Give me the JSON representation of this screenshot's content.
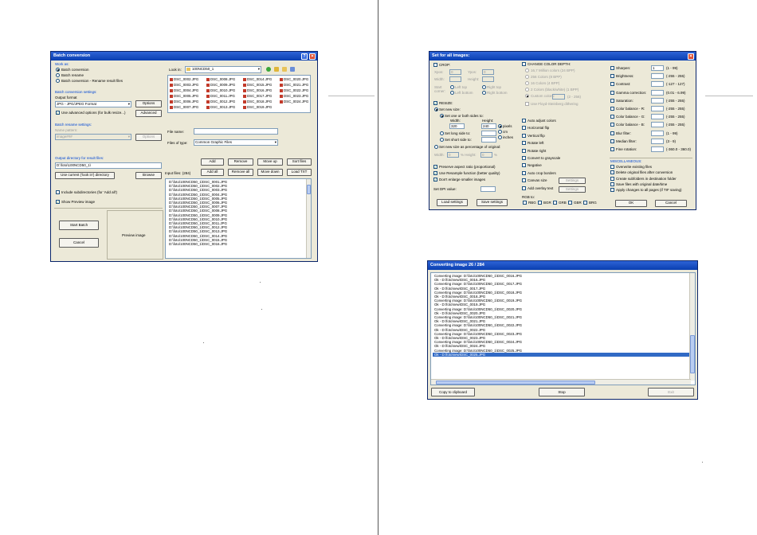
{
  "batch": {
    "title": "Batch conversion",
    "work_as": "Work as:",
    "mode_conversion": "Batch conversion",
    "mode_rename": "Batch rename",
    "mode_both": "Batch conversion - Rename result files",
    "settings_title": "Batch conversion settings:",
    "output_format_label": "Output format",
    "output_format": "JPG - JPG/JPEG Format",
    "options_btn": "Options",
    "advanced_check": "Use advanced options (for bulk resize...)",
    "advanced_btn": "Advanced",
    "rename_title": "Batch rename settings:",
    "name_pattern_label": "Name pattern:",
    "name_pattern": "image###",
    "rename_options_btn": "Options",
    "outdir_title": "Output directory for result files:",
    "outdir": "D:\\foto\\100NCD50_1\\",
    "use_current_btn": "Use current ('look in') directory",
    "browse_btn": "Browse",
    "include_subdirs": "Include subdirectories (for 'Add all')",
    "show_preview": "Show Preview image",
    "start_btn": "Start Batch",
    "cancel_btn": "Cancel",
    "preview_label": "Preview image",
    "look_in_label": "Look in:",
    "look_in": "100NCD50_1",
    "files": [
      "DSC_0002.JPG",
      "DSC_0003.JPG",
      "DSC_0004.JPG",
      "DSC_0005.JPG",
      "DSC_0006.JPG",
      "DSC_0007.JPG",
      "DSC_0008.JPG",
      "DSC_0009.JPG",
      "DSC_0010.JPG",
      "DSC_0011.JPG",
      "DSC_0012.JPG",
      "DSC_0013.JPG",
      "DSC_0014.JPG",
      "DSC_0015.JPG",
      "DSC_0016.JPG",
      "DSC_0017.JPG",
      "DSC_0018.JPG",
      "DSC_0019.JPG",
      "DSC_0020.JPG",
      "DSC_0021.JPG",
      "DSC_0022.JPG",
      "DSC_0023.JPG",
      "DSC_0024.JPG"
    ],
    "file_name_label": "File name:",
    "file_name": "",
    "file_type_label": "Files of type:",
    "file_type": "Common Graphic Files",
    "add_btn": "Add",
    "remove_btn": "Remove",
    "moveup_btn": "Move up",
    "sort_btn": "Sort files",
    "input_files_label": "Input files: (284)",
    "addall_btn": "Add all",
    "removeall_btn": "Remove all",
    "movedown_btn": "Move down",
    "loadtxt_btn": "Load TXT",
    "input_files": [
      "D:\\foto\\100NCD50_1\\DSC_0001.JPG",
      "D:\\foto\\100NCD50_1\\DSC_0002.JPG",
      "D:\\foto\\100NCD50_1\\DSC_0003.JPG",
      "D:\\foto\\100NCD50_1\\DSC_0004.JPG",
      "D:\\foto\\100NCD50_1\\DSC_0005.JPG",
      "D:\\foto\\100NCD50_1\\DSC_0006.JPG",
      "D:\\foto\\100NCD50_1\\DSC_0007.JPG",
      "D:\\foto\\100NCD50_1\\DSC_0008.JPG",
      "D:\\foto\\100NCD50_1\\DSC_0009.JPG",
      "D:\\foto\\100NCD50_1\\DSC_0010.JPG",
      "D:\\foto\\100NCD50_1\\DSC_0011.JPG",
      "D:\\foto\\100NCD50_1\\DSC_0012.JPG",
      "D:\\foto\\100NCD50_1\\DSC_0013.JPG",
      "D:\\foto\\100NCD50_1\\DSC_0014.JPG",
      "D:\\foto\\100NCD50_1\\DSC_0015.JPG",
      "D:\\foto\\100NCD50_1\\DSC_0016.JPG"
    ]
  },
  "setall": {
    "title": "Set for all images:",
    "crop": "CROP:",
    "xpos": "Xpos:",
    "ypos": "Ypos:",
    "width": "Width:",
    "height": "Height:",
    "xpos_val": "0",
    "ypos_val": "0",
    "start_corner": "Start corner:",
    "left_top": "Left top",
    "right_top": "Right top",
    "left_bottom": "Left bottom",
    "right_bottom": "Right bottom",
    "resize": "RESIZE:",
    "set_new_size": "Set new size:",
    "set_one_or_both": "Set one or both sides to:",
    "width_lbl": "Width:",
    "height_lbl": "Height:",
    "new_width": "320",
    "new_height": "240",
    "pixels": "pixels",
    "cm": "cm",
    "inches": "inches",
    "set_long": "Set long side to:",
    "set_short": "Set short side to:",
    "set_pct": "Set new size as percentage of original:",
    "pct_w": "Width:",
    "pct_w_val": "0",
    "pct_pct": "%",
    "pct_h": "% Height:",
    "pct_h_val": "0",
    "preserve": "Preserve aspect ratio (proportional)",
    "resample": "Use Resample function (better quality)",
    "dont_enlarge": "Don't enlarge smaller images",
    "dpi": "Set DPI value:",
    "load_btn": "Load settings",
    "save_btn": "Save settings",
    "color_depth": "CHANGE COLOR DEPTH:",
    "depths": [
      "16,7 Million colors (24 BPP)",
      "256 Colors (8 BPP)",
      "16 Colors (4 BPP)",
      "2 Colors (black/white) (1 BPP)",
      "Custom colors:"
    ],
    "custom_range": "(2 - 256)",
    "floyd": "Use Floyd-Steinberg dithering",
    "auto_adjust": "Auto adjust colors",
    "hflip": "Horizontal flip",
    "vflip": "Vertical flip",
    "rot_left": "Rotate left",
    "rot_right": "Rotate right",
    "grayscale": "Convert to grayscale",
    "negative": "Negative",
    "autocrop": "Auto crop borders",
    "canvas": "Canvas size",
    "canvas_btn": "Settings",
    "overlay": "Add overlay text",
    "overlay_btn": "Settings",
    "rgb_to": "RGB to:",
    "rgb_opts": [
      "RBG",
      "BGR",
      "GRB",
      "GBR",
      "BRG"
    ],
    "adj": [
      {
        "label": "Sharpen:",
        "val": "1",
        "range": "(1 - 99)"
      },
      {
        "label": "Brightness:",
        "val": "",
        "range": "(-255 - 255)"
      },
      {
        "label": "Contrast:",
        "val": "",
        "range": "(-127 - 127)"
      },
      {
        "label": "Gamma correction:",
        "val": "",
        "range": "(0.01 - 6.99)"
      },
      {
        "label": "Saturation:",
        "val": "",
        "range": "(-255 - 255)"
      },
      {
        "label": "Color balance - R:",
        "val": "",
        "range": "(-255 - 255)"
      },
      {
        "label": "Color balance - G:",
        "val": "",
        "range": "(-255 - 255)"
      },
      {
        "label": "Color balance - B:",
        "val": "",
        "range": "(-255 - 255)"
      },
      {
        "label": "Blur filter:",
        "val": "",
        "range": "(1 - 99)"
      },
      {
        "label": "Median filter:",
        "val": "",
        "range": "(3 - 9)"
      },
      {
        "label": "Fine rotation:",
        "val": "",
        "range": "(-360.0 - 360.0)"
      }
    ],
    "misc": "MISCELLANEOUS:",
    "misc_opts": [
      "Overwrite existing files",
      "Delete original files after conversion",
      "Create subfolders in destination folder",
      "Save files with original date/time",
      "Apply changes to all pages (if TIF saving)"
    ],
    "ok_btn": "OK",
    "cancel_btn": "Cancel"
  },
  "progress": {
    "title": "Converting image 26 / 284",
    "log": [
      "Converting image: D:\\foto\\100NCD50_1\\DSC_0016.JPG",
      "  Ok - D:\\foto\\new\\DSC_0016.JPG",
      "Converting image: D:\\foto\\100NCD50_1\\DSC_0017.JPG",
      "  Ok - D:\\foto\\new\\DSC_0017.JPG",
      "Converting image: D:\\foto\\100NCD50_1\\DSC_0018.JPG",
      "  Ok - D:\\foto\\new\\DSC_0018.JPG",
      "Converting image: D:\\foto\\100NCD50_1\\DSC_0019.JPG",
      "  Ok - D:\\foto\\new\\DSC_0019.JPG",
      "Converting image: D:\\foto\\100NCD50_1\\DSC_0020.JPG",
      "  Ok - D:\\foto\\new\\DSC_0020.JPG",
      "Converting image: D:\\foto\\100NCD50_1\\DSC_0021.JPG",
      "  Ok - D:\\foto\\new\\DSC_0021.JPG",
      "Converting image: D:\\foto\\100NCD50_1\\DSC_0022.JPG",
      "  Ok - D:\\foto\\new\\DSC_0022.JPG",
      "Converting image: D:\\foto\\100NCD50_1\\DSC_0023.JPG",
      "  Ok - D:\\foto\\new\\DSC_0023.JPG",
      "Converting image: D:\\foto\\100NCD50_1\\DSC_0024.JPG",
      "  Ok - D:\\foto\\new\\DSC_0024.JPG",
      "Converting image: D:\\foto\\100NCD50_1\\DSC_0025.JPG",
      "  Ok - D:\\foto\\new\\DSC_0025.JPG"
    ],
    "copy_btn": "Copy to clipboard",
    "stop_btn": "Stop",
    "exit_btn": "Exit"
  }
}
